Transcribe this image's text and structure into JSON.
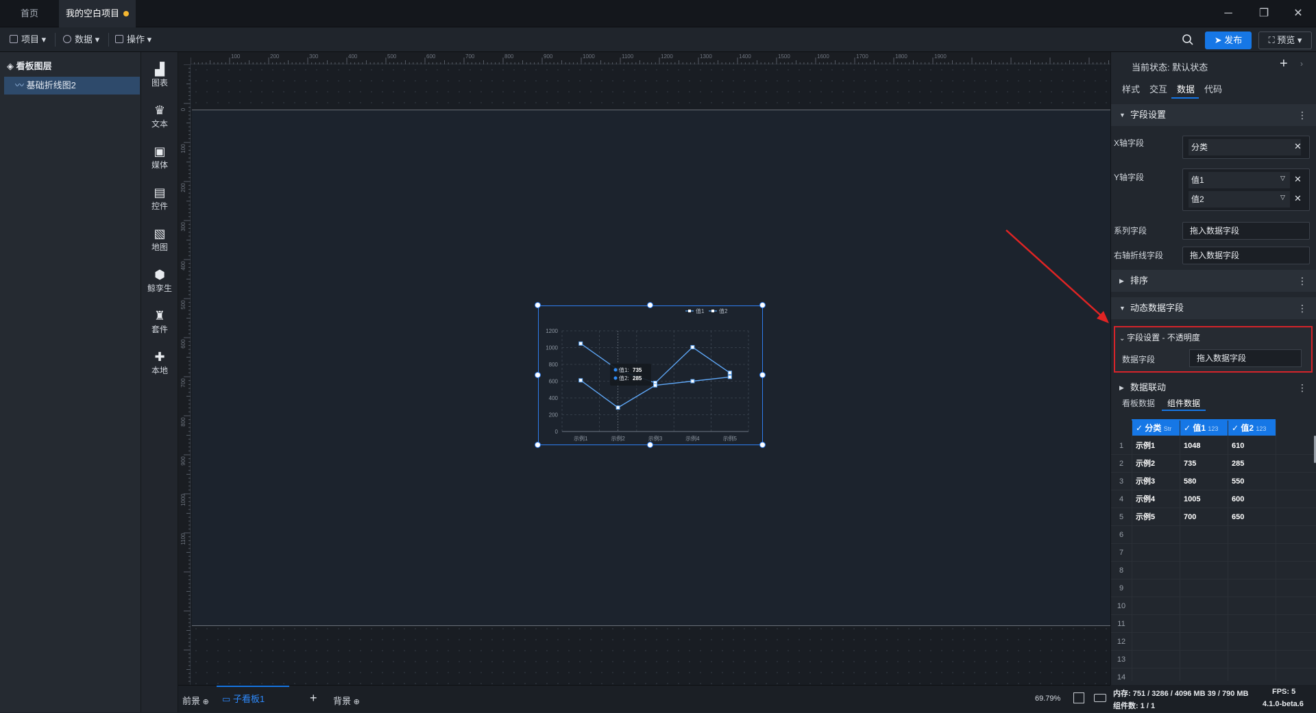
{
  "titlebar": {
    "tabs": [
      "首页",
      "我的空白项目"
    ],
    "window": {
      "minimize": "─",
      "restore": "❐",
      "close": "✕"
    }
  },
  "toolbar": {
    "menus": [
      "项目",
      "数据",
      "操作"
    ],
    "publish": "发布",
    "preview": "预览"
  },
  "left_panel": {
    "title": "看板图层",
    "layers": [
      "基础折线图2"
    ]
  },
  "components": [
    "图表",
    "文本",
    "媒体",
    "控件",
    "地图",
    "鲸孪生",
    "套件",
    "本地"
  ],
  "ruler": {
    "top": [
      "100",
      "200",
      "300",
      "400",
      "500",
      "600",
      "700",
      "800",
      "900",
      "1000",
      "1100",
      "1200",
      "1300",
      "1400",
      "1500",
      "1600",
      "1700",
      "1800",
      "1900"
    ],
    "left": [
      "0",
      "100",
      "200",
      "300",
      "400",
      "500",
      "600",
      "700",
      "800",
      "900",
      "1000",
      "1100"
    ]
  },
  "chart_data": {
    "type": "line",
    "categories": [
      "示例1",
      "示例2",
      "示例3",
      "示例4",
      "示例5"
    ],
    "series": [
      {
        "name": "值1",
        "values": [
          1048,
          735,
          580,
          1005,
          700
        ],
        "color": "#5ea6f5"
      },
      {
        "name": "值2",
        "values": [
          610,
          285,
          550,
          600,
          650
        ],
        "color": "#5ea6f5"
      }
    ],
    "yticks": [
      "0",
      "200",
      "400",
      "600",
      "800",
      "1000",
      "1200"
    ],
    "ylim": [
      0,
      1200
    ],
    "legend_position": "top-right",
    "grid": true,
    "tooltip": {
      "rows": [
        {
          "label": "值1:",
          "value": "735"
        },
        {
          "label": "值2:",
          "value": "285"
        }
      ]
    }
  },
  "bottom_bar": {
    "tabs": [
      "前景",
      "子看板1",
      "背景"
    ],
    "add": "+",
    "zoom": "69.79%"
  },
  "right_panel": {
    "state_label": "当前状态:",
    "state_value": "默认状态",
    "tabs": [
      "样式",
      "交互",
      "数据",
      "代码"
    ],
    "active_tab": "数据",
    "sections": {
      "field_settings": "字段设置",
      "sort": "排序",
      "dynamic_fields": "动态数据字段",
      "data_link": "数据联动"
    },
    "fields": {
      "x_label": "X轴字段",
      "x_value": "分类",
      "y_label": "Y轴字段",
      "y_values": [
        "值1",
        "值2"
      ],
      "series_label": "系列字段",
      "series_placeholder": "拖入数据字段",
      "right_axis_label": "右轴折线字段",
      "right_axis_placeholder": "拖入数据字段"
    },
    "opacity_box": {
      "title": "字段设置 - 不透明度",
      "label": "数据字段",
      "placeholder": "拖入数据字段"
    },
    "data_tabs": [
      "看板数据",
      "组件数据"
    ],
    "table": {
      "headers": [
        {
          "name": "分类",
          "type": "Str"
        },
        {
          "name": "值1",
          "type": "123"
        },
        {
          "name": "值2",
          "type": "123"
        }
      ],
      "rows": [
        [
          "示例1",
          "1048",
          "610"
        ],
        [
          "示例2",
          "735",
          "285"
        ],
        [
          "示例3",
          "580",
          "550"
        ],
        [
          "示例4",
          "1005",
          "600"
        ],
        [
          "示例5",
          "700",
          "650"
        ]
      ],
      "row_numbers": [
        "1",
        "2",
        "3",
        "4",
        "5",
        "6",
        "7",
        "8",
        "9",
        "10",
        "11",
        "12",
        "13",
        "14"
      ]
    }
  },
  "status": {
    "memory_label": "内存:",
    "memory_value": "751 / 3286 / 4096 MB  39 / 790 MB",
    "fps_label": "FPS:",
    "fps_value": "5",
    "components_label": "组件数:",
    "components_value": "1 / 1",
    "version": "4.1.0-beta.6"
  }
}
